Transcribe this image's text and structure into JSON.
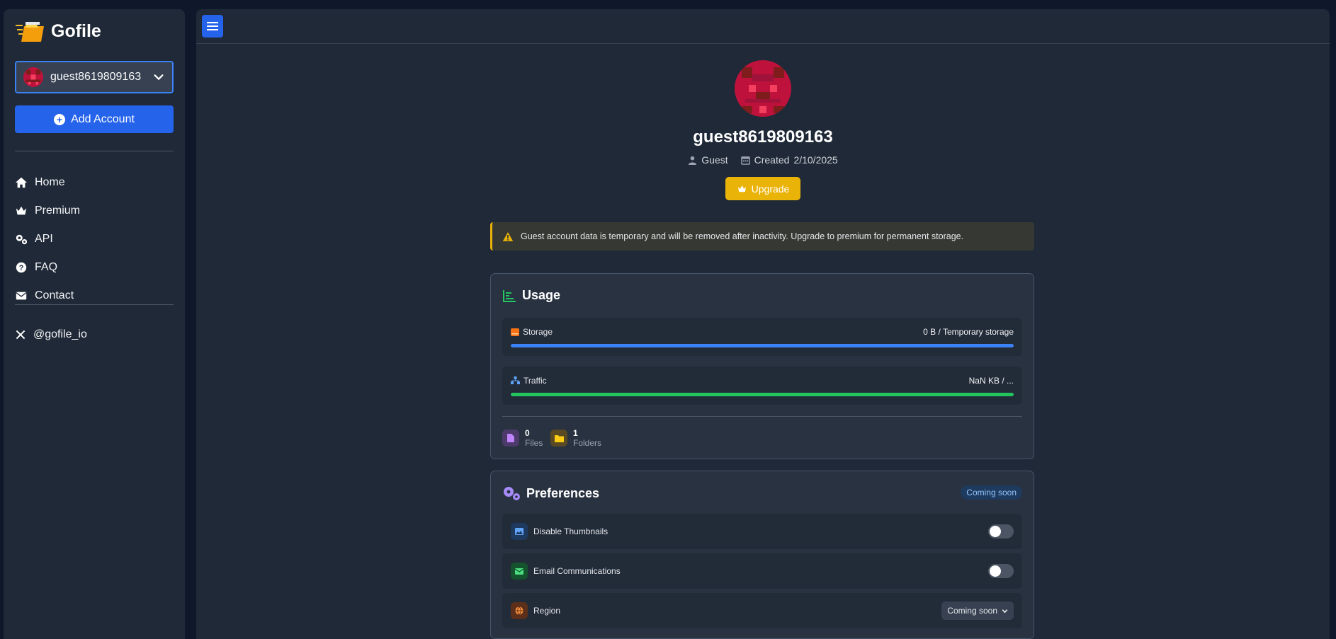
{
  "brand": {
    "name": "Gofile"
  },
  "account": {
    "name": "guest8619809163"
  },
  "sidebar": {
    "add_account": "Add Account",
    "nav": [
      {
        "label": "Home",
        "icon": "home-icon"
      },
      {
        "label": "Premium",
        "icon": "crown-icon"
      },
      {
        "label": "API",
        "icon": "gears-icon"
      },
      {
        "label": "FAQ",
        "icon": "question-icon"
      },
      {
        "label": "Contact",
        "icon": "envelope-icon"
      }
    ],
    "social": {
      "label": "@gofile_io",
      "icon": "x-icon"
    }
  },
  "profile": {
    "username": "guest8619809163",
    "role": "Guest",
    "created_label": "Created",
    "created_date": "2/10/2025",
    "upgrade": "Upgrade"
  },
  "alert": {
    "text": "Guest account data is temporary and will be removed after inactivity. Upgrade to premium for permanent storage."
  },
  "usage": {
    "title": "Usage",
    "storage": {
      "label": "Storage",
      "value": "0 B / Temporary storage",
      "fill_pct": 100,
      "color": "#3b82f6"
    },
    "traffic": {
      "label": "Traffic",
      "value": "NaN KB / ...",
      "fill_pct": 100,
      "color": "#22c55e"
    },
    "files": {
      "count": "0",
      "label": "Files"
    },
    "folders": {
      "count": "1",
      "label": "Folders"
    }
  },
  "preferences": {
    "title": "Preferences",
    "badge": "Coming soon",
    "items": [
      {
        "label": "Disable Thumbnails",
        "icon": "image-icon",
        "type": "toggle",
        "on": false
      },
      {
        "label": "Email Communications",
        "icon": "envelope-icon",
        "type": "toggle",
        "on": false
      },
      {
        "label": "Region",
        "icon": "globe-icon",
        "type": "select",
        "value": "Coming soon"
      }
    ]
  },
  "colors": {
    "accent": "#2563eb",
    "upgrade": "#eab308",
    "bg": "#0f172a",
    "panel": "#1f2937"
  }
}
